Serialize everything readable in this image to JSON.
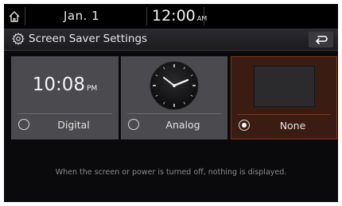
{
  "status_bar": {
    "date": "Jan.  1",
    "time": "12:00",
    "ampm": "AM"
  },
  "header": {
    "title": "Screen Saver Settings"
  },
  "options": [
    {
      "label": "Digital",
      "preview_time": "10:08",
      "preview_ampm": "PM",
      "selected": false
    },
    {
      "label": "Analog",
      "selected": false
    },
    {
      "label": "None",
      "selected": true
    }
  ],
  "info_text": "When the screen or power is turned off, nothing is displayed.",
  "colors": {
    "background": "#0a0a0c",
    "card": "#4b4b4f",
    "selected_card": "#3a1c12",
    "selected_border": "#8a3418",
    "info_text": "#8a8a8e"
  },
  "icons": {
    "home": "home-icon",
    "settings": "gear-icon",
    "back": "back-arrow-icon"
  }
}
